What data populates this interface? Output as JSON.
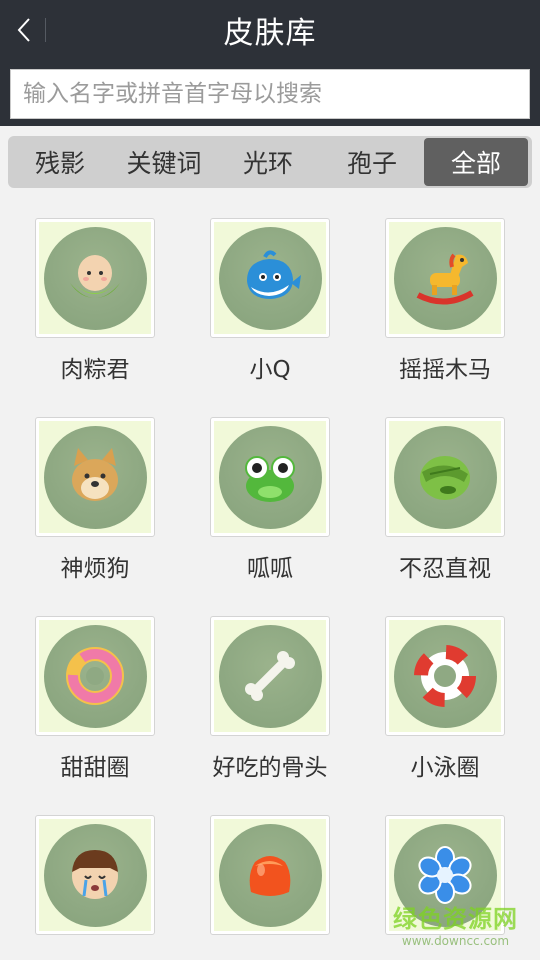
{
  "header": {
    "title": "皮肤库"
  },
  "search": {
    "placeholder": "输入名字或拼音首字母以搜索",
    "value": ""
  },
  "tabs": [
    {
      "label": "残影"
    },
    {
      "label": "关键词"
    },
    {
      "label": "光环"
    },
    {
      "label": "孢子"
    },
    {
      "label": "全部"
    }
  ],
  "skins": [
    {
      "name": "肉粽君",
      "icon": "rice-dumpling-icon"
    },
    {
      "name": "小Q",
      "icon": "blue-whale-icon"
    },
    {
      "name": "摇摇木马",
      "icon": "rocking-horse-icon"
    },
    {
      "name": "神烦狗",
      "icon": "doge-icon"
    },
    {
      "name": "呱呱",
      "icon": "frog-icon"
    },
    {
      "name": "不忍直视",
      "icon": "facepalm-frog-icon"
    },
    {
      "name": "甜甜圈",
      "icon": "donut-icon"
    },
    {
      "name": "好吃的骨头",
      "icon": "bone-icon"
    },
    {
      "name": "小泳圈",
      "icon": "swim-ring-icon"
    },
    {
      "name": "",
      "icon": "crying-kid-icon"
    },
    {
      "name": "",
      "icon": "jelly-icon"
    },
    {
      "name": "",
      "icon": "blue-flower-icon"
    }
  ],
  "watermark": {
    "line1": "绿色资源网",
    "line2": "www.downcc.com"
  },
  "colors": {
    "topbar": "#2d3138",
    "active_tab": "#606060",
    "disc": "#8fa983",
    "tile_bg": "#f1f9d9"
  }
}
